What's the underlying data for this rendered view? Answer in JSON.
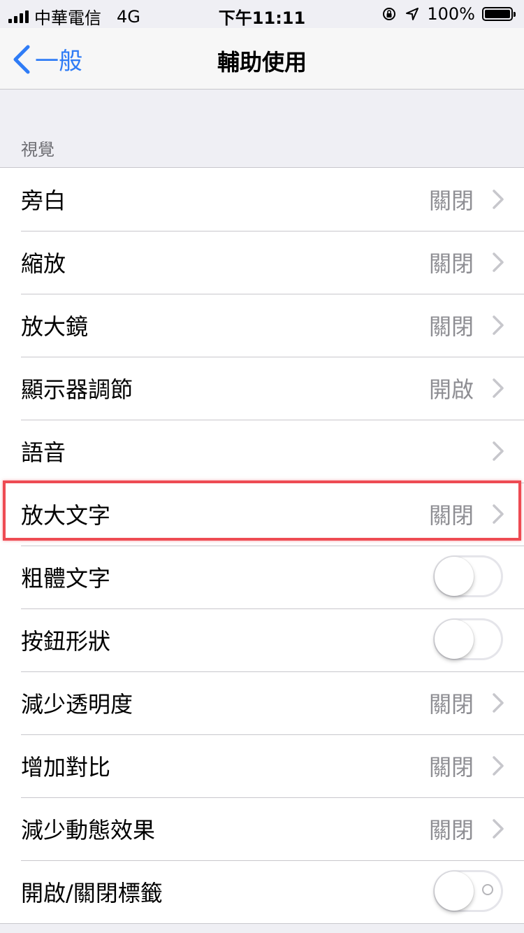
{
  "status_bar": {
    "carrier": "中華電信",
    "network": "4G",
    "time": "下午11:11",
    "battery": "100%"
  },
  "nav": {
    "back_label": "一般",
    "title": "輔助使用"
  },
  "section": {
    "header": "視覺"
  },
  "rows": [
    {
      "label": "旁白",
      "value": "關閉",
      "kind": "disclosure"
    },
    {
      "label": "縮放",
      "value": "關閉",
      "kind": "disclosure"
    },
    {
      "label": "放大鏡",
      "value": "關閉",
      "kind": "disclosure"
    },
    {
      "label": "顯示器調節",
      "value": "開啟",
      "kind": "disclosure"
    },
    {
      "label": "語音",
      "value": "",
      "kind": "disclosure"
    },
    {
      "label": "放大文字",
      "value": "關閉",
      "kind": "disclosure",
      "highlighted": true
    },
    {
      "label": "粗體文字",
      "kind": "toggle",
      "on": false
    },
    {
      "label": "按鈕形狀",
      "kind": "toggle",
      "on": false
    },
    {
      "label": "減少透明度",
      "value": "關閉",
      "kind": "disclosure"
    },
    {
      "label": "增加對比",
      "value": "關閉",
      "kind": "disclosure"
    },
    {
      "label": "減少動態效果",
      "value": "關閉",
      "kind": "disclosure"
    },
    {
      "label": "開啟/關閉標籤",
      "kind": "toggle",
      "on": false,
      "shows_off_label": true
    }
  ],
  "colors": {
    "accent": "#2f7cf6",
    "highlight": "#ee4b53"
  }
}
